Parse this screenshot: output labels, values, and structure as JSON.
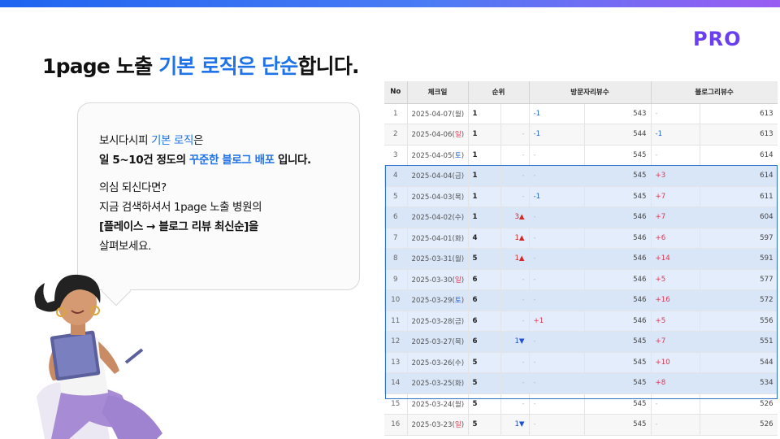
{
  "brand": {
    "pro_label": "PRO"
  },
  "headline": {
    "part1": "1page 노출 ",
    "part2": "기본 로직은 단순",
    "part3": "합니다."
  },
  "bubble": {
    "line1_a": "보시다시피 ",
    "line1_b": "기본 로직",
    "line1_c": "은",
    "line2_a": "일 5~10건 정도의 ",
    "line2_b": "꾸준한 블로그 배포",
    "line2_c": " 입니다.",
    "line3": "의심 되신다면?",
    "line4": "지금 검색하셔서 1page 노출 병원의",
    "line5": "[플레이스 → 블로그 리뷰 최신순]을",
    "line6": "살펴보세요."
  },
  "table": {
    "headers": [
      "No",
      "체크일",
      "순위",
      "방문자리뷰수",
      "블로그리뷰수"
    ],
    "rows": [
      {
        "no": "1",
        "date": "2025-04-07",
        "day": "월",
        "day_type": "",
        "rank": "1",
        "rank_chg": "",
        "rank_dir": "",
        "visit_delta": "-1",
        "visit": "543",
        "blog_delta": "-",
        "blog": "613"
      },
      {
        "no": "2",
        "date": "2025-04-06",
        "day": "일",
        "day_type": "sun",
        "rank": "1",
        "rank_chg": "-",
        "rank_dir": "",
        "visit_delta": "-1",
        "visit": "544",
        "blog_delta": "-1",
        "blog": "613"
      },
      {
        "no": "3",
        "date": "2025-04-05",
        "day": "토",
        "day_type": "sat",
        "rank": "1",
        "rank_chg": "-",
        "rank_dir": "",
        "visit_delta": "-",
        "visit": "545",
        "blog_delta": "-",
        "blog": "614"
      },
      {
        "no": "4",
        "date": "2025-04-04",
        "day": "금",
        "day_type": "",
        "rank": "1",
        "rank_chg": "-",
        "rank_dir": "",
        "visit_delta": "-",
        "visit": "545",
        "blog_delta": "+3",
        "blog": "614"
      },
      {
        "no": "5",
        "date": "2025-04-03",
        "day": "목",
        "day_type": "",
        "rank": "1",
        "rank_chg": "-",
        "rank_dir": "",
        "visit_delta": "-1",
        "visit": "545",
        "blog_delta": "+7",
        "blog": "611"
      },
      {
        "no": "6",
        "date": "2025-04-02",
        "day": "수",
        "day_type": "",
        "rank": "1",
        "rank_chg": "3▲",
        "rank_dir": "up",
        "visit_delta": "-",
        "visit": "546",
        "blog_delta": "+7",
        "blog": "604"
      },
      {
        "no": "7",
        "date": "2025-04-01",
        "day": "화",
        "day_type": "",
        "rank": "4",
        "rank_chg": "1▲",
        "rank_dir": "up",
        "visit_delta": "-",
        "visit": "546",
        "blog_delta": "+6",
        "blog": "597"
      },
      {
        "no": "8",
        "date": "2025-03-31",
        "day": "월",
        "day_type": "",
        "rank": "5",
        "rank_chg": "1▲",
        "rank_dir": "up",
        "visit_delta": "-",
        "visit": "546",
        "blog_delta": "+14",
        "blog": "591"
      },
      {
        "no": "9",
        "date": "2025-03-30",
        "day": "일",
        "day_type": "sun",
        "rank": "6",
        "rank_chg": "-",
        "rank_dir": "",
        "visit_delta": "-",
        "visit": "546",
        "blog_delta": "+5",
        "blog": "577"
      },
      {
        "no": "10",
        "date": "2025-03-29",
        "day": "토",
        "day_type": "sat",
        "rank": "6",
        "rank_chg": "-",
        "rank_dir": "",
        "visit_delta": "-",
        "visit": "546",
        "blog_delta": "+16",
        "blog": "572"
      },
      {
        "no": "11",
        "date": "2025-03-28",
        "day": "금",
        "day_type": "",
        "rank": "6",
        "rank_chg": "-",
        "rank_dir": "",
        "visit_delta": "+1",
        "visit": "546",
        "blog_delta": "+5",
        "blog": "556"
      },
      {
        "no": "12",
        "date": "2025-03-27",
        "day": "목",
        "day_type": "",
        "rank": "6",
        "rank_chg": "1▼",
        "rank_dir": "down",
        "visit_delta": "-",
        "visit": "545",
        "blog_delta": "+7",
        "blog": "551"
      },
      {
        "no": "13",
        "date": "2025-03-26",
        "day": "수",
        "day_type": "",
        "rank": "5",
        "rank_chg": "-",
        "rank_dir": "",
        "visit_delta": "-",
        "visit": "545",
        "blog_delta": "+10",
        "blog": "544"
      },
      {
        "no": "14",
        "date": "2025-03-25",
        "day": "화",
        "day_type": "",
        "rank": "5",
        "rank_chg": "-",
        "rank_dir": "",
        "visit_delta": "-",
        "visit": "545",
        "blog_delta": "+8",
        "blog": "534"
      },
      {
        "no": "15",
        "date": "2025-03-24",
        "day": "월",
        "day_type": "",
        "rank": "5",
        "rank_chg": "-",
        "rank_dir": "",
        "visit_delta": "-",
        "visit": "545",
        "blog_delta": "-",
        "blog": "526"
      },
      {
        "no": "16",
        "date": "2025-03-23",
        "day": "일",
        "day_type": "sun",
        "rank": "5",
        "rank_chg": "1▼",
        "rank_dir": "down",
        "visit_delta": "-",
        "visit": "545",
        "blog_delta": "-",
        "blog": "526"
      }
    ],
    "highlight_rows": [
      "4",
      "14"
    ]
  }
}
